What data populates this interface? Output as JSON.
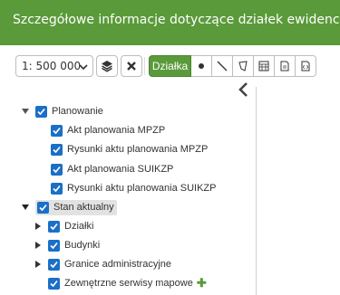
{
  "header": {
    "title": "Szczegółowe informacje dotyczące działek ewidencyjnych ora"
  },
  "toolbar": {
    "scale_value": "1: 500 000",
    "active_mode": "Działka",
    "icons": [
      "layers-icon",
      "clear-icon",
      "point-icon",
      "line-icon",
      "polygon-icon",
      "table-icon",
      "report-icon",
      "export-icon"
    ]
  },
  "tree": {
    "items": [
      {
        "label": "Planowanie",
        "level": 0,
        "expanded": true,
        "checked": true
      },
      {
        "label": "Akt planowania MPZP",
        "level": 1,
        "checked": true
      },
      {
        "label": "Rysunki aktu planowania MPZP",
        "level": 1,
        "checked": true
      },
      {
        "label": "Akt planowania SUIKZP",
        "level": 1,
        "checked": true
      },
      {
        "label": "Rysunki aktu planowania SUIKZP",
        "level": 1,
        "checked": true
      },
      {
        "label": "Stan aktualny",
        "level": 0,
        "expanded": true,
        "checked": true,
        "selected": true
      },
      {
        "label": "Działki",
        "level": 1,
        "collapsed": true,
        "checked": true
      },
      {
        "label": "Budynki",
        "level": 1,
        "collapsed": true,
        "checked": true
      },
      {
        "label": "Granice administracyjne",
        "level": 1,
        "collapsed": true,
        "checked": true
      },
      {
        "label": "Zewnętrzne serwisy mapowe",
        "level": 1,
        "checked": true,
        "addable": true
      }
    ]
  },
  "colors": {
    "header_green": "#5a9a3a",
    "checkbox_blue": "#1a6fc7"
  }
}
